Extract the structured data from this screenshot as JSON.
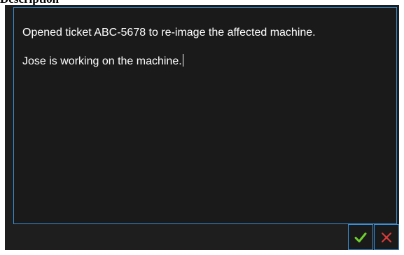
{
  "header": {
    "label": "Description"
  },
  "editor": {
    "paragraph_1": "Opened ticket  ABC-5678 to re-image the affected machine.",
    "paragraph_2": "Jose is working on the machine."
  },
  "actions": {
    "confirm_icon": "checkmark-icon",
    "cancel_icon": "x-icon",
    "confirm_color": "#6fcf2f",
    "cancel_color": "#e03b3b"
  },
  "colors": {
    "panel_background": "#1e1e1e",
    "border_accent": "#3a8fd6",
    "text": "#ffffff"
  }
}
